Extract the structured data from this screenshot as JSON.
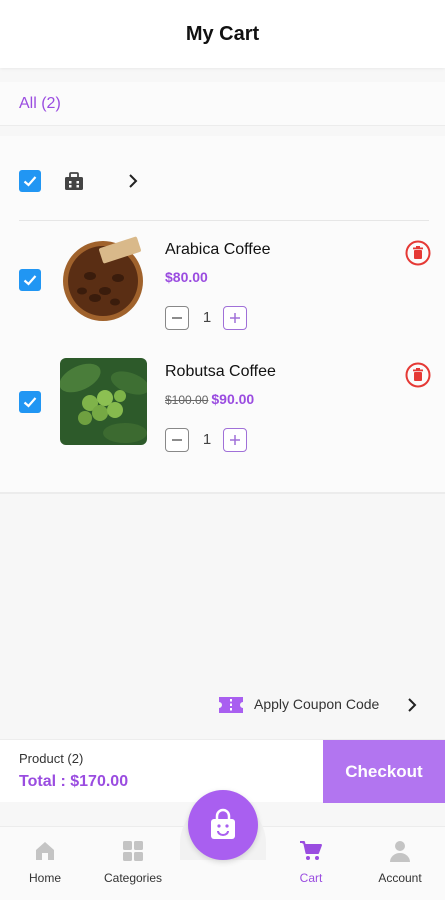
{
  "header": {
    "title": "My Cart"
  },
  "filter": {
    "label": "All (2)"
  },
  "store": {
    "checked": true,
    "icon": "store-icon"
  },
  "items": [
    {
      "name": "Arabica Coffee",
      "old_price": "",
      "price": "$80.00",
      "quantity": "1",
      "checked": true
    },
    {
      "name": "Robutsa Coffee",
      "old_price": "$100.00",
      "price": "$90.00",
      "quantity": "1",
      "checked": true
    }
  ],
  "coupon": {
    "label": "Apply Coupon Code"
  },
  "footer": {
    "product_count": "Product (2)",
    "total": "Total : $170.00",
    "checkout_label": "Checkout"
  },
  "nav": [
    {
      "label": "Home",
      "icon": "home-icon"
    },
    {
      "label": "Categories",
      "icon": "categories-icon"
    },
    {
      "label": "Cart",
      "icon": "cart-icon",
      "active": true
    },
    {
      "label": "Account",
      "icon": "account-icon"
    }
  ],
  "colors": {
    "accent": "#9a4ce0",
    "checkbox": "#2196f3",
    "delete": "#e53935",
    "checkout_bg": "#b275f0"
  }
}
